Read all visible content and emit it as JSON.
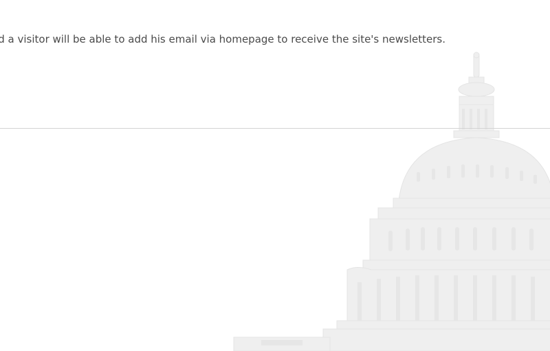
{
  "content": {
    "description": "ed a visitor will be able to add his email via homepage to receive the site's newsletters."
  },
  "background": {
    "image_icon": "capitol-building-watermark"
  },
  "colors": {
    "text": "#4a4a4a",
    "divider": "#d3d3d3",
    "watermark": "#eeeeee",
    "background": "#ffffff"
  }
}
